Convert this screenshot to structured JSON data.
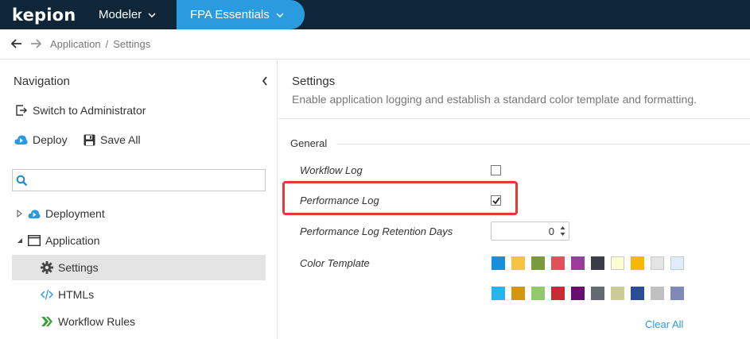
{
  "topbar": {
    "logo": "kepion",
    "modeler_label": "Modeler",
    "fpa_label": "FPA Essentials"
  },
  "breadcrumb": {
    "items": [
      "Application",
      "Settings"
    ],
    "separator": "/"
  },
  "navigation": {
    "title": "Navigation",
    "switch_label": "Switch to Administrator",
    "deploy_label": "Deploy",
    "save_all_label": "Save All",
    "search_value": "",
    "tree": [
      {
        "label": "Deployment",
        "icon": "cloud-icon",
        "expander": "collapsed"
      },
      {
        "label": "Application",
        "icon": "window-icon",
        "expander": "expanded"
      },
      {
        "label": "Settings",
        "icon": "gear-icon",
        "selected": true
      },
      {
        "label": "HTMLs",
        "icon": "code-icon"
      },
      {
        "label": "Workflow Rules",
        "icon": "chevrons-icon"
      }
    ]
  },
  "settings": {
    "title": "Settings",
    "description": "Enable application logging and establish a standard color template and formatting.",
    "group_label": "General",
    "workflow_log_label": "Workflow Log",
    "workflow_log_checked": false,
    "performance_log_label": "Performance Log",
    "performance_log_checked": true,
    "retention_label": "Performance Log Retention Days",
    "retention_value": "0",
    "color_template_label": "Color Template",
    "colors_row1": [
      "#1590e0",
      "#f6c244",
      "#7a9a3c",
      "#e2505a",
      "#9c3b9a",
      "#3a3d48",
      "#fdfcd2",
      "#f7b900",
      "#e4e4e4",
      "#e0ecfa"
    ],
    "colors_row2": [
      "#27b3ee",
      "#d4960c",
      "#93c96e",
      "#c52c36",
      "#6a0e6e",
      "#646871",
      "#cbcb98",
      "#2a4e96",
      "#c0c0c0",
      "#8089b8"
    ],
    "clear_all_label": "Clear All"
  },
  "colors": {
    "topbar_bg": "#0e2638",
    "accent": "#2b9be0",
    "highlight": "#e53838"
  }
}
